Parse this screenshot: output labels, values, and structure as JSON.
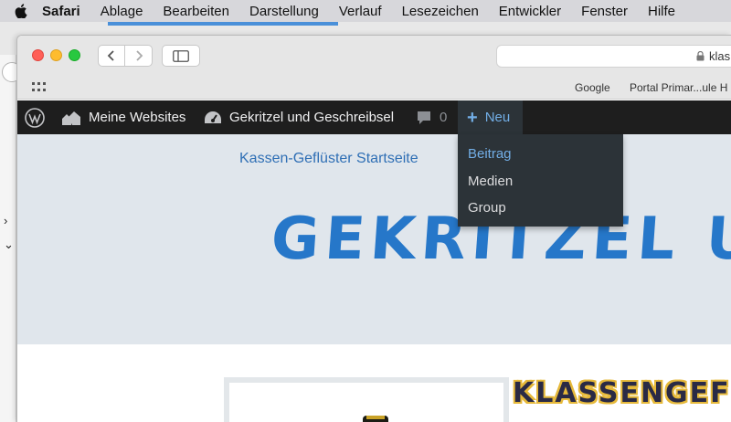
{
  "menubar": {
    "app_name": "Safari",
    "items": [
      "Ablage",
      "Bearbeiten",
      "Darstellung",
      "Verlauf",
      "Lesezeichen",
      "Entwickler",
      "Fenster",
      "Hilfe"
    ]
  },
  "browser": {
    "address_text": "klas",
    "favorites": [
      "Google",
      "Portal Primar...ule H"
    ]
  },
  "adminbar": {
    "my_sites": "Meine Websites",
    "site_name": "Gekritzel und Geschreibsel",
    "comments_count": "0",
    "new_label": "Neu",
    "new_menu": [
      "Beitrag",
      "Medien",
      "Group"
    ]
  },
  "page": {
    "home_link": "Kassen-Geflüster Startseite",
    "site_title": "GEKRITZEL U",
    "widget_title": "KLASSENGEFLUE"
  },
  "colors": {
    "adminbar_bg": "#1e1e1e",
    "dropdown_bg": "#2c3338",
    "wp_blue": "#72aee6",
    "title_blue": "#2677c9"
  }
}
